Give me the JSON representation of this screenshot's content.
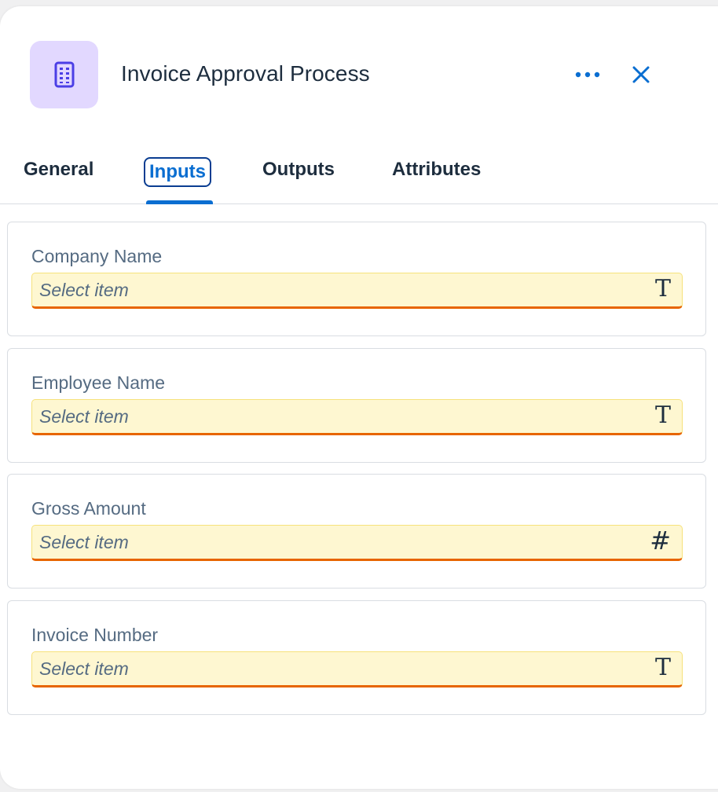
{
  "header": {
    "title": "Invoice Approval Process",
    "app_icon": "calculator-icon",
    "more_icon": "more-horizontal-icon",
    "close_icon": "close-icon"
  },
  "tabs": [
    {
      "label": "General",
      "active": false
    },
    {
      "label": "Inputs",
      "active": true
    },
    {
      "label": "Outputs",
      "active": false
    },
    {
      "label": "Attributes",
      "active": false
    }
  ],
  "fields": [
    {
      "label": "Company Name",
      "placeholder": "Select item",
      "type_icon": "T",
      "type_icon_name": "text-type-icon"
    },
    {
      "label": "Employee Name",
      "placeholder": "Select item",
      "type_icon": "T",
      "type_icon_name": "text-type-icon"
    },
    {
      "label": "Gross Amount",
      "placeholder": "Select item",
      "type_icon": "#",
      "type_icon_name": "number-type-icon"
    },
    {
      "label": "Invoice Number",
      "placeholder": "Select item",
      "type_icon": "T",
      "type_icon_name": "text-type-icon"
    }
  ],
  "colors": {
    "accent": "#0a6ed1",
    "input_warning_bg": "#fef7d1",
    "input_warning_border": "#e76500",
    "app_icon_bg": "#e2d8ff"
  }
}
